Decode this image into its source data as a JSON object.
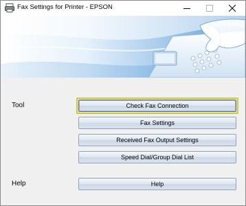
{
  "window": {
    "title": "Fax Settings for Printer - EPSON"
  },
  "sections": {
    "tool_label": "Tool",
    "help_label": "Help"
  },
  "buttons": {
    "check_fax_connection": "Check Fax Connection",
    "fax_settings": "Fax Settings",
    "received_fax_output_settings": "Received Fax Output Settings",
    "speed_dial_group_dial_list": "Speed Dial/Group Dial List",
    "help": "Help"
  },
  "icons": {
    "app": "printer-fax-icon",
    "minimize": "minimize-icon",
    "maximize": "maximize-icon",
    "close": "close-icon"
  },
  "colors": {
    "banner_light": "#e8f2fb",
    "banner_mid": "#9cc5e8",
    "banner_dark": "#2f78c4",
    "focus_ring": "#c8cc3a"
  }
}
